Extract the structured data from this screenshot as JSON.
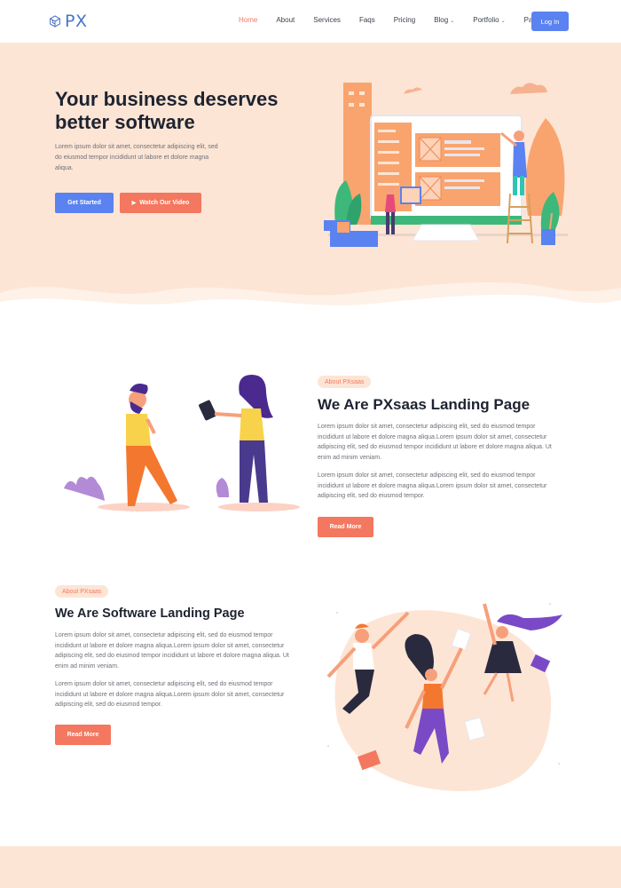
{
  "brand": {
    "name": "PX",
    "logo_icon": "cube-icon",
    "color": "#4a74c9"
  },
  "nav": {
    "items": [
      {
        "label": "Home",
        "active": true,
        "dropdown": false
      },
      {
        "label": "About",
        "active": false,
        "dropdown": false
      },
      {
        "label": "Services",
        "active": false,
        "dropdown": false
      },
      {
        "label": "Faqs",
        "active": false,
        "dropdown": false
      },
      {
        "label": "Pricing",
        "active": false,
        "dropdown": false
      },
      {
        "label": "Blog",
        "active": false,
        "dropdown": true
      },
      {
        "label": "Portfolio",
        "active": false,
        "dropdown": true
      },
      {
        "label": "Pages",
        "active": false,
        "dropdown": true
      }
    ],
    "login_label": "Log In"
  },
  "hero": {
    "title": "Your business deserves better software",
    "description": "Lorem ipsum dolor sit amet, consectetur adipiscing elit, sed do eiusmod tempor incididunt ut labore et dolore magna aliqua.",
    "primary_button": "Get Started",
    "secondary_button": "Watch Our Video"
  },
  "about": {
    "badge": "About PXsaas",
    "title": "We Are PXsaas Landing Page",
    "paragraph1": "Lorem ipsum dolor sit amet, consectetur adipiscing elit, sed do eiusmod tempor incididunt ut labore et dolore magna aliqua.Lorem ipsum dolor sit amet, consectetur adipiscing elit, sed do eiusmod tempor incididunt ut labore et dolore magna aliqua. Ut enim ad minim veniam.",
    "paragraph2": "Lorem ipsum dolor sit amet, consectetur adipiscing elit, sed do eiusmod tempor incididunt ut labore et dolore magna aliqua.Lorem ipsum dolor sit amet, consectetur adipiscing elit, sed do eiusmod tempor.",
    "button": "Read More"
  },
  "software": {
    "badge": "About PXsaas",
    "title": "We Are Software Landing Page",
    "paragraph1": "Lorem ipsum dolor sit amet, consectetur adipiscing elit, sed do eiusmod tempor incididunt ut labore et dolore magna aliqua.Lorem ipsum dolor sit amet, consectetur adipiscing elit, sed do eiusmod tempor incididunt ut labore et dolore magna aliqua. Ut enim ad minim veniam.",
    "paragraph2": "Lorem ipsum dolor sit amet, consectetur adipiscing elit, sed do eiusmod tempor incididunt ut labore et dolore magna aliqua.Lorem ipsum dolor sit amet, consectetur adipiscing elit, sed do eiusmod tempor.",
    "button": "Read More"
  },
  "colors": {
    "accent": "#f4775f",
    "primary": "#5a82f0",
    "hero_bg": "#fde5d5",
    "text_dark": "#1e2330",
    "text_muted": "#6e6f78"
  }
}
